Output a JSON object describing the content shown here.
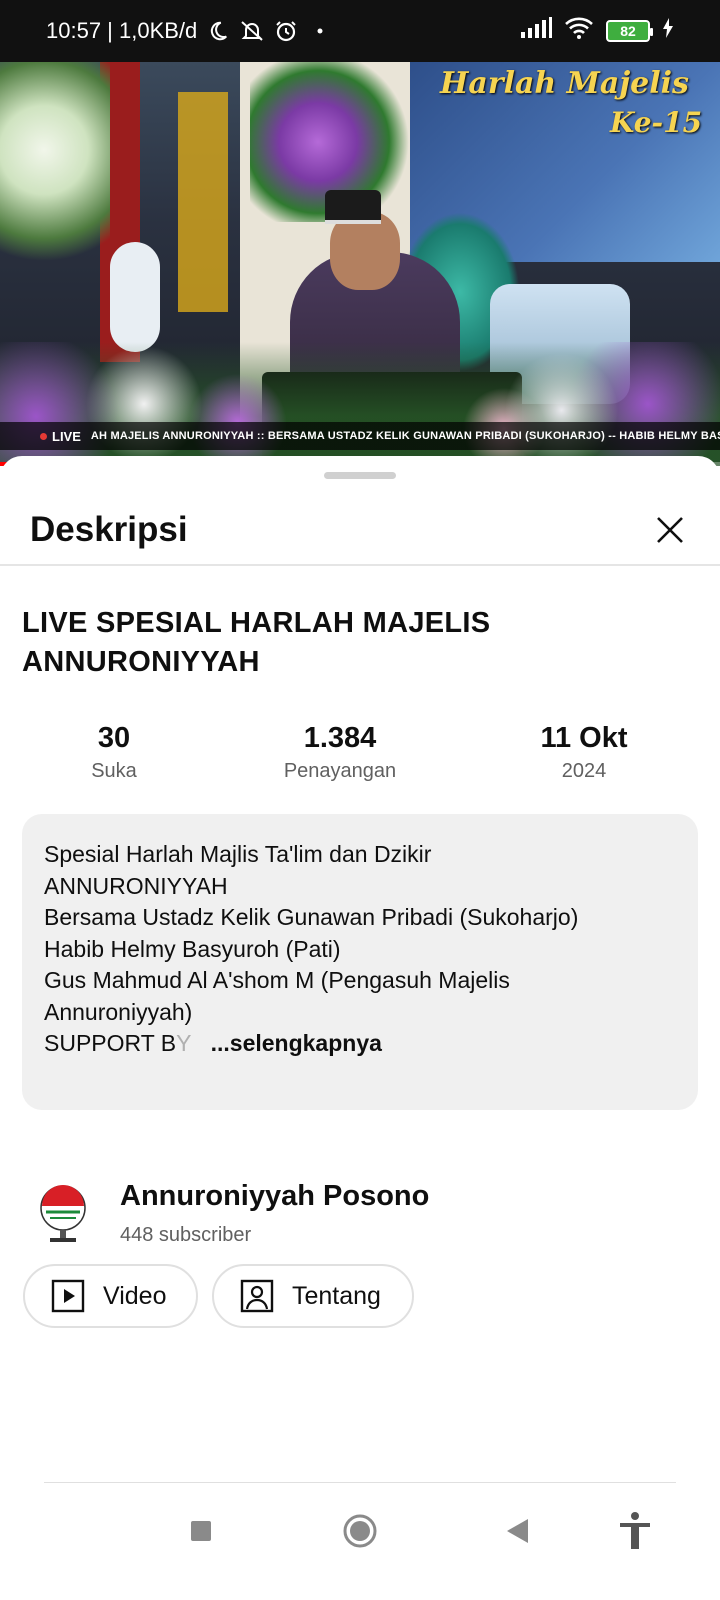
{
  "status_bar": {
    "time_network": "10:57 | 1,0KB/d",
    "battery": "82",
    "icons": [
      "moon-icon",
      "notifications-off-icon",
      "alarm-icon",
      "dot-icon",
      "signal-icon",
      "wifi-icon",
      "battery-icon",
      "charging-icon"
    ]
  },
  "video": {
    "banner_title": "Harlah Majelis",
    "banner_sub": "Ke-15",
    "live_label": "LIVE",
    "ticker": "AH MAJELIS ANNURONIYYAH :: BERSAMA USTADZ KELIK GUNAWAN PRIBADI (SUKOHARJO) -- HABIB HELMY BASYU",
    "progress_fraction": 0.385
  },
  "sheet": {
    "title": "Deskripsi",
    "close_icon": "close-icon"
  },
  "video_info": {
    "title": "LIVE SPESIAL HARLAH MAJELIS ANNURONIYYAH",
    "stats": [
      {
        "value": "30",
        "label": "Suka"
      },
      {
        "value": "1.384",
        "label": "Penayangan"
      },
      {
        "value": "11 Okt",
        "label": "2024"
      }
    ]
  },
  "description": {
    "lines": [
      "Spesial Harlah Majlis Ta'lim dan Dzikir",
      "ANNURONIYYAH",
      "Bersama Ustadz Kelik Gunawan Pribadi (Sukoharjo)",
      "Habib Helmy Basyuroh (Pati)",
      "Gus Mahmud Al A'shom M (Pengasuh Majelis",
      "Annuroniyyah)"
    ],
    "last_line_start": "SUPPORT B",
    "last_line_fade": "Y",
    "more_label": "...selengkapnya"
  },
  "channel": {
    "name": "Annuroniyyah Posono",
    "subscribers": "448 subscriber",
    "buttons": [
      {
        "label": "Video",
        "icon": "play-box-icon"
      },
      {
        "label": "Tentang",
        "icon": "person-box-icon"
      }
    ]
  },
  "nav_bar": {
    "buttons": [
      "recents-icon",
      "home-icon",
      "back-icon",
      "accessibility-icon"
    ]
  },
  "colors": {
    "accent_red": "#ff0000",
    "text_primary": "#0f0f0f",
    "text_secondary": "#606060",
    "desc_background": "#f0f0f0"
  }
}
